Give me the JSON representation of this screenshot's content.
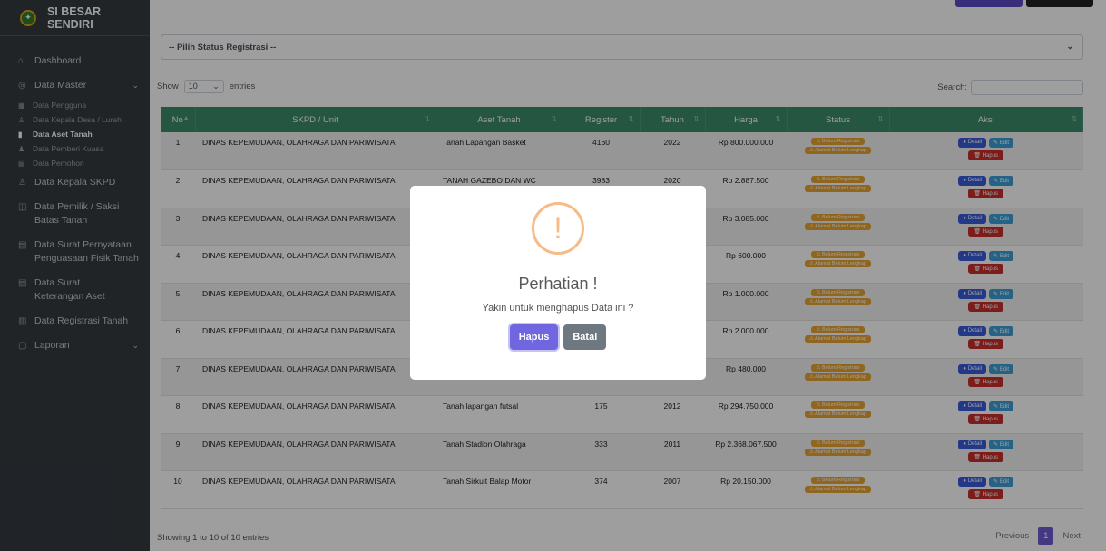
{
  "app": {
    "title": "SI BESAR SENDIRI"
  },
  "sidebar": {
    "items": [
      {
        "label": "Dashboard",
        "icon": "home-icon"
      },
      {
        "label": "Data Master",
        "icon": "database-icon",
        "chevron": "⌄"
      },
      {
        "label": "Data Kepala SKPD",
        "icon": "user-icon"
      },
      {
        "label": "Data Pemilik / Saksi",
        "label2": "Batas Tanah",
        "icon": "users-icon"
      },
      {
        "label": "Data Surat Pernyataan",
        "label2": "Penguasaan Fisik Tanah",
        "icon": "document-icon"
      },
      {
        "label": "Data Surat",
        "label2": "Keterangan Aset",
        "icon": "document-icon"
      },
      {
        "label": "Data Registrasi Tanah",
        "icon": "chart-icon"
      },
      {
        "label": "Laporan",
        "icon": "file-icon",
        "chevron": "⌄"
      }
    ],
    "subitems": [
      {
        "label": "Data Pengguna",
        "icon": "users-icon"
      },
      {
        "label": "Data Kepala Desa / Lurah",
        "icon": "user-icon"
      },
      {
        "label": "Data Aset Tanah",
        "icon": "file-icon"
      },
      {
        "label": "Data Pemberi Kuasa",
        "icon": "user-icon"
      },
      {
        "label": "Data Pemohon",
        "icon": "id-card-icon"
      }
    ]
  },
  "filter": {
    "status_placeholder": "-- Pilih Status Registrasi --",
    "chevron": "⌄"
  },
  "table_controls": {
    "show": "Show",
    "entries_value": "10",
    "entries": "entries",
    "search": "Search:"
  },
  "table": {
    "headers": [
      "No",
      "SKPD / Unit",
      "Aset Tanah",
      "Register",
      "Tahun",
      "Harga",
      "Status",
      "Aksi"
    ],
    "badge1": "⚠ Belum Registrasi",
    "badge2": "⚠ Alamat Belum Lengkap",
    "btn_detail": "● Detail",
    "btn_edit": "✎ Edit",
    "btn_hapus": "🗑 Hapus",
    "rows": [
      {
        "no": "1",
        "skpd": "DINAS KEPEMUDAAN, OLAHRAGA DAN PARIWISATA",
        "aset": "Tanah Lapangan Basket",
        "register": "4160",
        "tahun": "2022",
        "harga": "Rp 800.000.000"
      },
      {
        "no": "2",
        "skpd": "DINAS KEPEMUDAAN, OLAHRAGA DAN PARIWISATA",
        "aset": "TANAH GAZEBO DAN WC",
        "register": "3983",
        "tahun": "2020",
        "harga": "Rp 2.887.500"
      },
      {
        "no": "3",
        "skpd": "DINAS KEPEMUDAAN, OLAHRAGA DAN PARIWISATA",
        "aset": "",
        "register": "",
        "tahun": "",
        "harga": "Rp 3.085.000"
      },
      {
        "no": "4",
        "skpd": "DINAS KEPEMUDAAN, OLAHRAGA DAN PARIWISATA",
        "aset": "",
        "register": "",
        "tahun": "",
        "harga": "Rp 600.000"
      },
      {
        "no": "5",
        "skpd": "DINAS KEPEMUDAAN, OLAHRAGA DAN PARIWISATA",
        "aset": "",
        "register": "",
        "tahun": "",
        "harga": "Rp 1.000.000"
      },
      {
        "no": "6",
        "skpd": "DINAS KEPEMUDAAN, OLAHRAGA DAN PARIWISATA",
        "aset": "",
        "register": "",
        "tahun": "",
        "harga": "Rp 2.000.000"
      },
      {
        "no": "7",
        "skpd": "DINAS KEPEMUDAAN, OLAHRAGA DAN PARIWISATA",
        "aset": "",
        "register": "",
        "tahun": "",
        "harga": "Rp 480.000"
      },
      {
        "no": "8",
        "skpd": "DINAS KEPEMUDAAN, OLAHRAGA DAN PARIWISATA",
        "aset": "Tanah lapangan futsal",
        "register": "175",
        "tahun": "2012",
        "harga": "Rp 294.750.000"
      },
      {
        "no": "9",
        "skpd": "DINAS KEPEMUDAAN, OLAHRAGA DAN PARIWISATA",
        "aset": "Tanah Stadion Olahraga",
        "register": "333",
        "tahun": "2011",
        "harga": "Rp 2.368.067.500"
      },
      {
        "no": "10",
        "skpd": "DINAS KEPEMUDAAN, OLAHRAGA DAN PARIWISATA",
        "aset": "Tanah Sirkuit Balap Motor",
        "register": "374",
        "tahun": "2007",
        "harga": "Rp 20.150.000"
      }
    ]
  },
  "footer": {
    "info": "Showing 1 to 10 of 10 entries",
    "previous": "Previous",
    "page": "1",
    "next": "Next"
  },
  "modal": {
    "icon": "!",
    "title": "Perhatian !",
    "text": "Yakin untuk menghapus Data ini ?",
    "confirm": "Hapus",
    "cancel": "Batal"
  },
  "colors": {
    "sidebar": "#343a40",
    "table_header": "#3c8c6a",
    "confirm": "#7066e0",
    "cancel": "#6e7881",
    "badge": "#e8a331",
    "warning": "#f8bb86"
  }
}
